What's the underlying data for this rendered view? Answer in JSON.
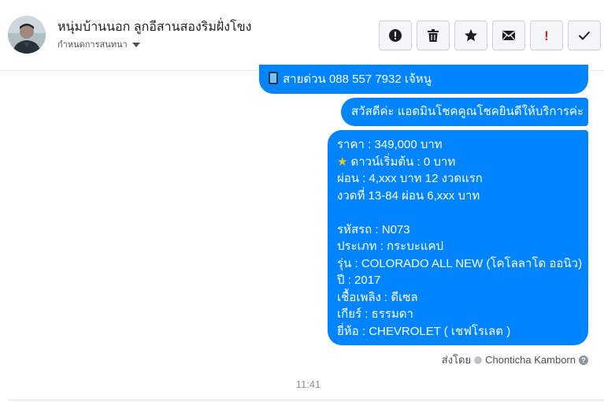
{
  "header": {
    "title": "หนุ่มบ้านนอก ลูกอีสานสองริมฝั่งโขง",
    "subtitle": "กำหนดการสนทนา"
  },
  "toolbar": {
    "buttons": [
      {
        "name": "report",
        "icon": "exclamation-circle-icon"
      },
      {
        "name": "delete",
        "icon": "trash-icon"
      },
      {
        "name": "star",
        "icon": "star-icon"
      },
      {
        "name": "mark-unread",
        "icon": "envelope-icon"
      },
      {
        "name": "spam",
        "icon": "red-exclamation-icon",
        "label": "!"
      },
      {
        "name": "done",
        "icon": "check-icon"
      }
    ]
  },
  "messages": {
    "m1": "สายด่วน 088 557 7932 เจ้หนู",
    "m2": "สวัสดีค่ะ แอดมินโชคคูณโชคยินดีให้บริการค่ะ",
    "m3": [
      "ราคา : 349,000 บาท",
      "ดาวน์เริ่มต้น : 0 บาท",
      "ผ่อน : 4,xxx บาท 12 งวดแรก",
      "งวดที่ 13-84 ผ่อน 6,xxx บาท",
      "",
      "รหัสรถ : N073",
      "ประเภท : กระบะแคป",
      "รุ่น : COLORADO ALL NEW (โคโลลาโด ออนิว)",
      "ปี : 2017",
      "เชื้อเพลิง : ดีเซล",
      "เกียร์ : ธรรมดา",
      "ยี่ห้อ : CHEVROLET ( เชฟโรเลต )"
    ]
  },
  "sent_by": {
    "prefix": "ส่งโดย",
    "name": "Chonticha Kamborn",
    "help": "?"
  },
  "timestamp": "11:41",
  "colors": {
    "bubble": "#0084ff",
    "spam": "#e02020"
  }
}
